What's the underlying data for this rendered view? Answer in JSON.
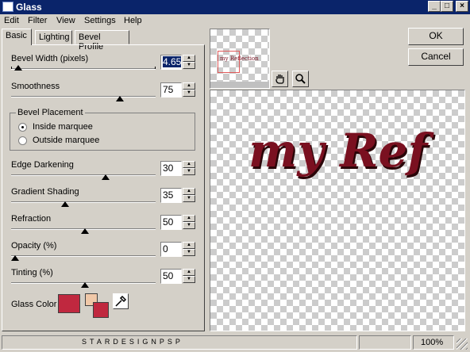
{
  "window": {
    "title": "Glass"
  },
  "menu": [
    "Edit",
    "Filter",
    "View",
    "Settings",
    "Help"
  ],
  "tabs": [
    {
      "label": "Basic",
      "active": true
    },
    {
      "label": "Lighting",
      "active": false
    },
    {
      "label": "Bevel Profile",
      "active": false
    }
  ],
  "controls": {
    "bevel_width": {
      "label": "Bevel Width (pixels)",
      "value": "4.65"
    },
    "smoothness": {
      "label": "Smoothness",
      "value": "75"
    },
    "edge_darkening": {
      "label": "Edge Darkening",
      "value": "30"
    },
    "gradient_shading": {
      "label": "Gradient Shading",
      "value": "35"
    },
    "refraction": {
      "label": "Refraction",
      "value": "50"
    },
    "opacity": {
      "label": "Opacity (%)",
      "value": "0"
    },
    "tinting": {
      "label": "Tinting (%)",
      "value": "50"
    }
  },
  "bevel_placement": {
    "title": "Bevel Placement",
    "options": [
      "Inside marquee",
      "Outside marquee"
    ],
    "selected": "Inside marquee"
  },
  "glass_color": {
    "label": "Glass Color",
    "color": "#c0283f",
    "secondary_color": "#f0c8a8"
  },
  "buttons": {
    "ok": "OK",
    "cancel": "Cancel"
  },
  "preview": {
    "text": "my Ref",
    "thumb_text": "my Reflection",
    "text_color": "#7a1020"
  },
  "tools": [
    "hand-icon",
    "zoom-icon"
  ],
  "status": {
    "watermark": "STARDESIGNPSP",
    "zoom": "100%"
  }
}
